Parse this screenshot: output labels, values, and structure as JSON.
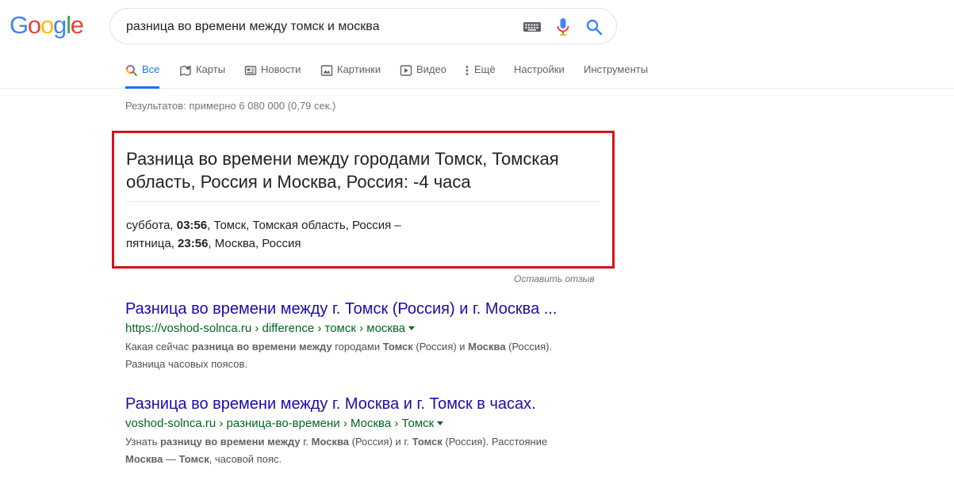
{
  "logo": {
    "letters": [
      "G",
      "o",
      "o",
      "g",
      "l",
      "e"
    ],
    "colors": [
      "#4285f4",
      "#ea4335",
      "#fbbc05",
      "#4285f4",
      "#34a853",
      "#ea4335"
    ]
  },
  "search": {
    "query": "разница во времени между томск и москва"
  },
  "tabs": [
    {
      "label": "Все",
      "icon": "search-icon",
      "active": true
    },
    {
      "label": "Карты",
      "icon": "map-icon"
    },
    {
      "label": "Новости",
      "icon": "news-icon"
    },
    {
      "label": "Картинки",
      "icon": "image-icon"
    },
    {
      "label": "Видео",
      "icon": "video-icon"
    },
    {
      "label": "Ещё",
      "icon": "more-vert-icon"
    },
    {
      "label": "Настройки"
    },
    {
      "label": "Инструменты"
    }
  ],
  "stats": "Результатов: примерно 6 080 000 (0,79 сек.)",
  "card": {
    "title": "Разница во времени между городами Томск, Томская область, Россия и Москва, Россия: -4 часа",
    "line1_prefix": "суббота, ",
    "line1_time": "03:56",
    "line1_suffix": ", Томск, Томская область, Россия –",
    "line2_prefix": "пятница, ",
    "line2_time": "23:56",
    "line2_suffix": ", Москва, Россия",
    "border_color": "#d21318"
  },
  "feedback": "Оставить отзыв",
  "results": [
    {
      "title": "Разница во времени между г. Томск (Россия) и г. Москва ...",
      "url": "https://voshod-solnca.ru › difference › томск › москва",
      "snippet_parts": [
        {
          "t": "Какая сейчас "
        },
        {
          "t": "разница во времени между",
          "b": true
        },
        {
          "t": " городами "
        },
        {
          "t": "Томск",
          "b": true
        },
        {
          "t": " (Россия) и "
        },
        {
          "t": "Москва",
          "b": true
        },
        {
          "t": " (Россия)."
        },
        {
          "br": true
        },
        {
          "t": "Разница часовых поясов."
        }
      ]
    },
    {
      "title": "Разница во времени между г. Москва и г. Томск в часах.",
      "url": "voshod-solnca.ru › разница-во-времени › Москва › Томск",
      "snippet_parts": [
        {
          "t": "Узнать "
        },
        {
          "t": "разницу во времени между",
          "b": true
        },
        {
          "t": " г. "
        },
        {
          "t": "Москва",
          "b": true
        },
        {
          "t": " (Россия) и г. "
        },
        {
          "t": "Томск",
          "b": true
        },
        {
          "t": " (Россия). Расстояние"
        },
        {
          "br": true
        },
        {
          "t": "Москва",
          "b": true
        },
        {
          "t": " — "
        },
        {
          "t": "Томск",
          "b": true
        },
        {
          "t": ", часовой пояс."
        }
      ]
    }
  ]
}
